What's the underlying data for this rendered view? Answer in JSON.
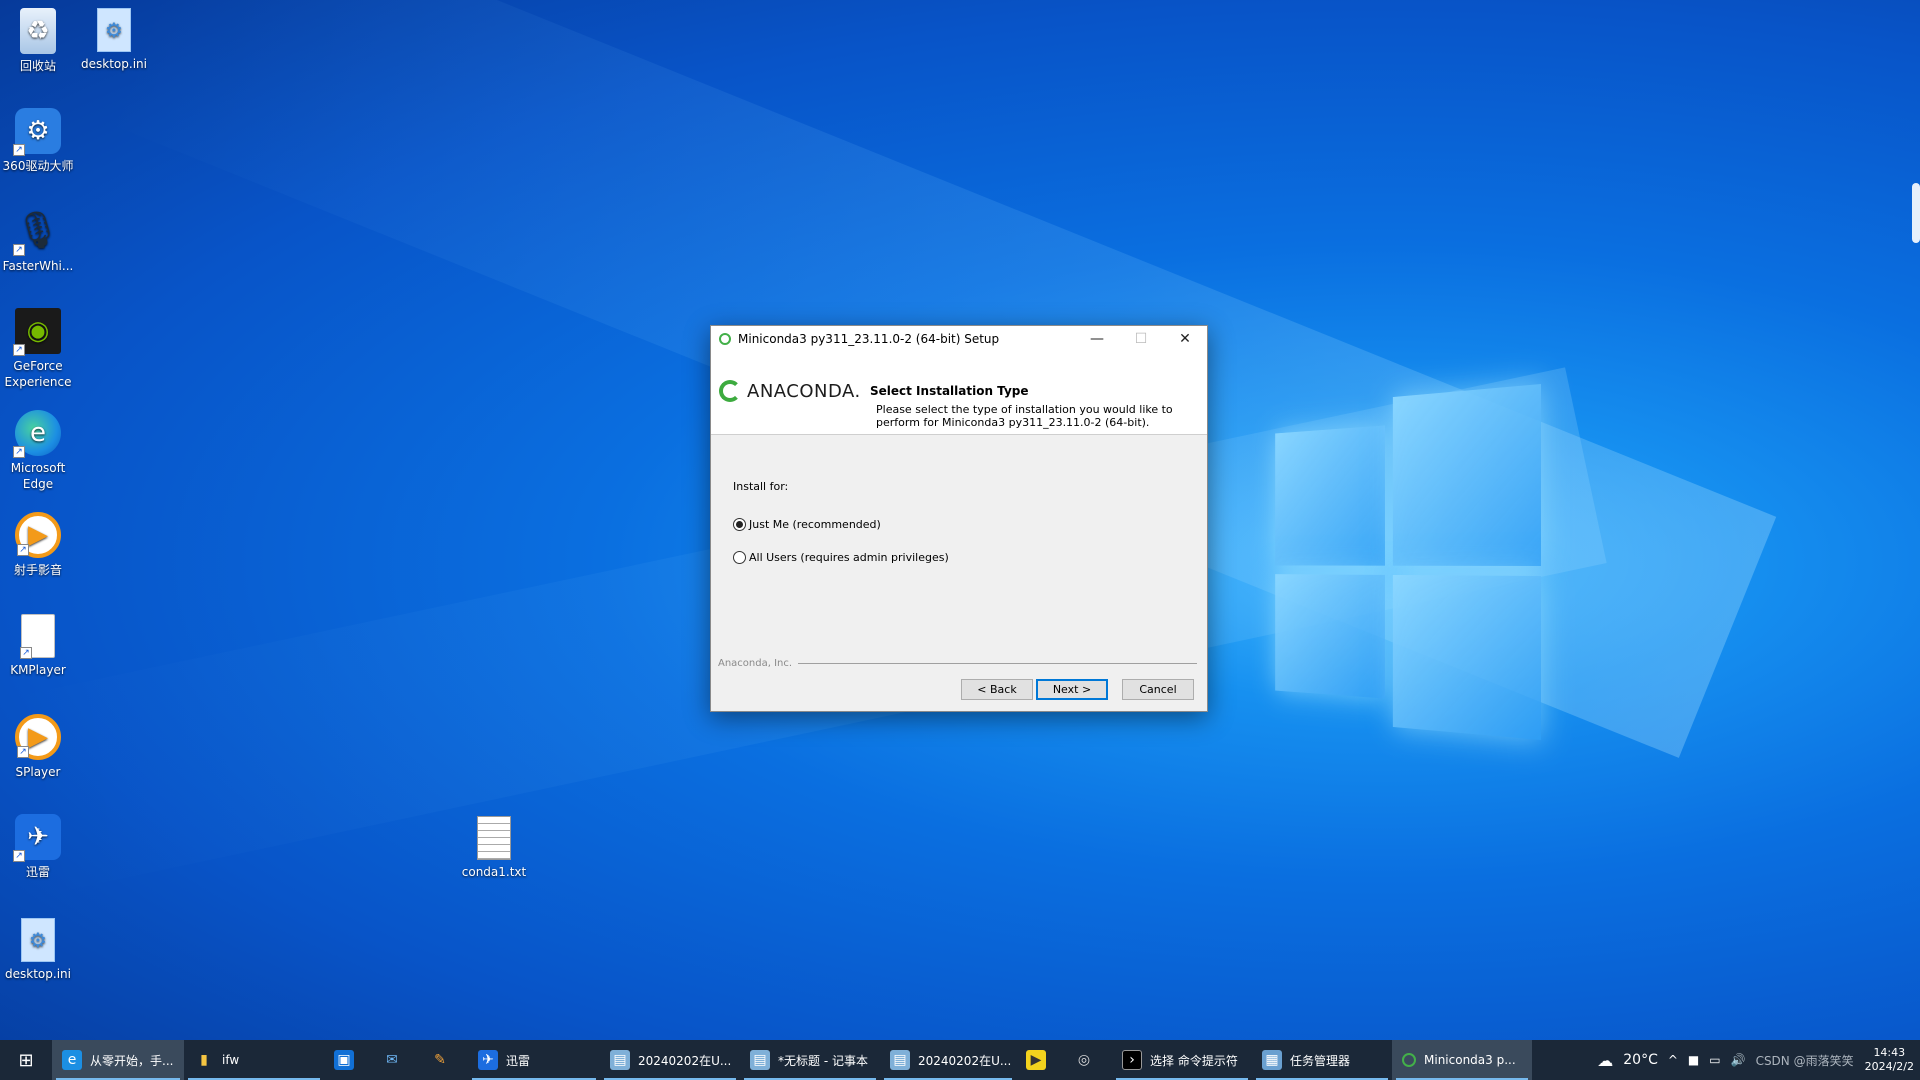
{
  "desktop": {
    "icons": [
      {
        "label": "回收站"
      },
      {
        "label": "desktop.ini"
      },
      {
        "label": "360驱动大师"
      },
      {
        "label": "FasterWhi..."
      },
      {
        "label": "GeForce Experience"
      },
      {
        "label": "Microsoft Edge"
      },
      {
        "label": "射手影音"
      },
      {
        "label": "KMPlayer"
      },
      {
        "label": "SPlayer"
      },
      {
        "label": "迅雷"
      },
      {
        "label": "desktop.ini"
      },
      {
        "label": "conda1.txt"
      }
    ]
  },
  "dialog": {
    "title": "Miniconda3 py311_23.11.0-2 (64-bit) Setup",
    "logo_text": "ANACONDA.",
    "header_title": "Select Installation Type",
    "header_desc": "Please select the type of installation you would like to perform for Miniconda3 py311_23.11.0-2 (64-bit).",
    "install_for_label": "Install for:",
    "options": [
      {
        "label": "Just Me (recommended)",
        "checked": true
      },
      {
        "label": "All Users (requires admin privileges)",
        "checked": false
      }
    ],
    "brand": "Anaconda, Inc.",
    "buttons": {
      "back": "< Back",
      "next": "Next >",
      "cancel": "Cancel"
    },
    "title_buttons": {
      "minimize": "—",
      "maximize": "☐",
      "close": "✕"
    }
  },
  "taskbar": {
    "start_icon": "windows-start-icon",
    "items": [
      {
        "label": "从零开始，手...",
        "icon": "edge-icon"
      },
      {
        "label": "ifw",
        "icon": "folder-icon"
      },
      {
        "label": "",
        "icon": "store-icon"
      },
      {
        "label": "",
        "icon": "mail-icon"
      },
      {
        "label": "",
        "icon": "paint-icon"
      },
      {
        "label": "迅雷",
        "icon": "xunlei-icon"
      },
      {
        "label": "20240202在U...",
        "icon": "notepad-icon"
      },
      {
        "label": "*无标题 - 记事本",
        "icon": "notepad-icon"
      },
      {
        "label": "20240202在U...",
        "icon": "notepad-icon"
      },
      {
        "label": "",
        "icon": "kmplayer-icon"
      },
      {
        "label": "",
        "icon": "obs-icon"
      },
      {
        "label": "选择 命令提示符",
        "icon": "cmd-icon"
      },
      {
        "label": "任务管理器",
        "icon": "taskmgr-icon"
      },
      {
        "label": "Miniconda3 p...",
        "icon": "conda-icon"
      }
    ],
    "tray": {
      "temperature": "20°C",
      "watermark": "CSDN @雨落笑笑",
      "time": "14:43",
      "date": "2024/2/2"
    }
  }
}
